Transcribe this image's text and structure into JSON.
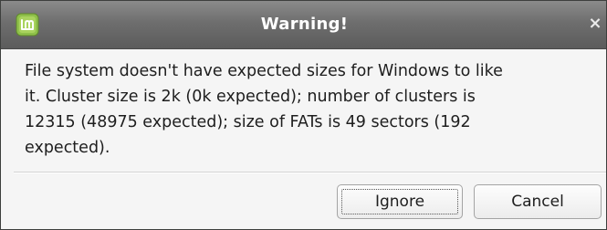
{
  "dialog": {
    "title": "Warning!",
    "close_symbol": "×",
    "icon": "linux-mint-icon",
    "message": "File system doesn't have expected sizes for Windows to like\nit. Cluster size is 2k (0k expected); number of clusters is\n12315 (48975 expected); size of FATs is 49 sectors (192\nexpected).",
    "buttons": {
      "ignore_label": "Ignore",
      "cancel_label": "Cancel"
    }
  },
  "colors": {
    "titlebar": "#6e6e6e",
    "icon_green": "#8fc04a",
    "dialog_bg": "#f5f5f5"
  }
}
